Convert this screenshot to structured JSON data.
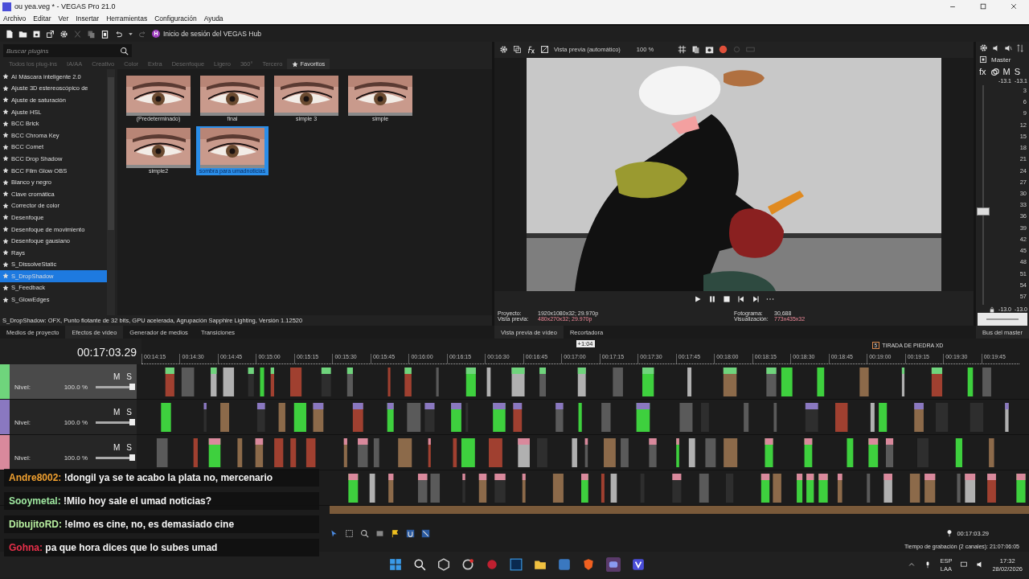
{
  "window": {
    "title": "ou yea.veg * - VEGAS Pro 21.0"
  },
  "menu": [
    "Archivo",
    "Editar",
    "Ver",
    "Insertar",
    "Herramientas",
    "Configuración",
    "Ayuda"
  ],
  "toolbar": {
    "hub_badge": "H",
    "hub_label": "Inicio de sesión del VEGAS Hub"
  },
  "plugins": {
    "search_placeholder": "Buscar plugins",
    "categories": [
      {
        "label": "Todos los plug-ins",
        "selected": false
      },
      {
        "label": "IA/AA",
        "selected": false
      },
      {
        "label": "Creativo",
        "selected": false
      },
      {
        "label": "Color",
        "selected": false
      },
      {
        "label": "Extra",
        "selected": false
      },
      {
        "label": "Desenfoque",
        "selected": false
      },
      {
        "label": "Ligero",
        "selected": false
      },
      {
        "label": "360°",
        "selected": false
      },
      {
        "label": "Tercero",
        "selected": false
      },
      {
        "label": "Favoritos",
        "selected": true
      }
    ],
    "items": [
      {
        "label": "AI Máscara inteligente 2.0",
        "selected": false
      },
      {
        "label": "Ajuste 3D estereoscópico de",
        "selected": false
      },
      {
        "label": "Ajuste de saturación",
        "selected": false
      },
      {
        "label": "Ajuste HSL",
        "selected": false
      },
      {
        "label": "BCC Brick",
        "selected": false
      },
      {
        "label": "BCC Chroma Key",
        "selected": false
      },
      {
        "label": "BCC Comet",
        "selected": false
      },
      {
        "label": "BCC Drop Shadow",
        "selected": false
      },
      {
        "label": "BCC Film Glow OBS",
        "selected": false
      },
      {
        "label": "Blanco y negro",
        "selected": false
      },
      {
        "label": "Clave cromática",
        "selected": false
      },
      {
        "label": "Corrector de color",
        "selected": false
      },
      {
        "label": "Desenfoque",
        "selected": false
      },
      {
        "label": "Desenfoque de movimiento",
        "selected": false
      },
      {
        "label": "Desenfoque gausiano",
        "selected": false
      },
      {
        "label": "Rays",
        "selected": false
      },
      {
        "label": "S_DissolveStatic",
        "selected": false
      },
      {
        "label": "S_DropShadow",
        "selected": true
      },
      {
        "label": "S_Feedback",
        "selected": false
      },
      {
        "label": "S_GlowEdges",
        "selected": false
      }
    ],
    "presets": [
      {
        "label": "(Predeterminado)",
        "selected": false
      },
      {
        "label": "final",
        "selected": false
      },
      {
        "label": "simple 3",
        "selected": false
      },
      {
        "label": "simple",
        "selected": false
      },
      {
        "label": "simple2",
        "selected": false
      },
      {
        "label": "sombra para umadnoticias",
        "selected": true
      }
    ],
    "description": "S_DropShadow: OFX, Punto flotante de 32 bits, GPU acelerada, Agrupación  Sapphire Lighting, Versión 1.12520"
  },
  "preview": {
    "mode": "Vista previa (automático)",
    "zoom": "100 %",
    "info_left": [
      {
        "label": "Proyecto:",
        "value": "1920x1080x32; 29.970p",
        "highlight": false
      },
      {
        "label": "Vista previa:",
        "value": "480x270x32; 29.970p",
        "highlight": true
      }
    ],
    "info_right": [
      {
        "label": "Fotograma:",
        "value": "30,688",
        "highlight": false
      },
      {
        "label": "Visualización:",
        "value": "773x435x32",
        "highlight": true
      }
    ]
  },
  "mixer": {
    "title": "Master",
    "fx": "fx",
    "mute": "M",
    "solo": "S",
    "peaks": [
      "-13.1",
      "-13.1"
    ],
    "scale": [
      "3",
      "6",
      "9",
      "12",
      "15",
      "18",
      "21",
      "24",
      "27",
      "30",
      "33",
      "36",
      "39",
      "42",
      "45",
      "48",
      "51",
      "54",
      "57"
    ],
    "levels": [
      "-13.0",
      "-13.0"
    ],
    "tab": "Bus del master"
  },
  "dock_tabs_left": [
    {
      "label": "Medios de proyecto",
      "selected": false
    },
    {
      "label": "Efectos de vídeo",
      "selected": true
    },
    {
      "label": "Generador de medios",
      "selected": false
    },
    {
      "label": "Transiciones",
      "selected": false
    }
  ],
  "dock_tabs_right": [
    {
      "label": "Vista previa de vídeo",
      "selected": true
    },
    {
      "label": "Recortadora",
      "selected": false
    }
  ],
  "timeline": {
    "timecode": "00:17:03.29",
    "cursor_offset": "+1:04",
    "marker": {
      "number": "5",
      "label": "TIRADA DE PIEDRA XD"
    },
    "ruler": [
      "00:14:15",
      "00:14:30",
      "00:14:45",
      "00:15:00",
      "00:15:15",
      "00:15:30",
      "00:15:45",
      "00:16:00",
      "00:16:15",
      "00:16:30",
      "00:16:45",
      "00:17:00",
      "00:17:15",
      "00:17:30",
      "00:17:45",
      "00:18:00",
      "00:18:15",
      "00:18:30",
      "00:18:45",
      "00:19:00",
      "00:19:15",
      "00:19:30",
      "00:19:45"
    ],
    "tracks": [
      {
        "color": "#6fd47c",
        "selected": true,
        "mute": "M",
        "solo": "S",
        "level_label": "Nivel:",
        "level_value": "100.0 %",
        "level": 1
      },
      {
        "color": "#8a78c0",
        "selected": false,
        "mute": "M",
        "solo": "S",
        "level_label": "Nivel:",
        "level_value": "100.0 %",
        "level": 1
      },
      {
        "color": "#d9899c",
        "selected": false,
        "mute": "M",
        "solo": "S",
        "level_label": "Nivel:",
        "level_value": "100.0 %",
        "level": 1
      }
    ]
  },
  "bottom_bar": {
    "time": "00:17:03.29",
    "status": "Tiempo de grabación (2 canales): 21:07:06:05"
  },
  "chat": [
    {
      "user": "Andre8002:",
      "color": "#f0a030",
      "message": "!dongil ya se te acabo la plata no, mercenario"
    },
    {
      "user": "Sooymetal:",
      "color": "#9fe8a0",
      "message": "!Milo hoy sale el umad noticias?"
    },
    {
      "user": "DibujitoRD:",
      "color": "#b8f0a0",
      "message": "!elmo es cine, no, es demasiado cine"
    },
    {
      "user": "Gohna:",
      "color": "#e8304a",
      "message": "pa que hora dices que lo subes umad"
    }
  ],
  "taskbar": {
    "language": "ESP",
    "layout": "LAA",
    "time": "17:32",
    "date": "28/02/2026"
  }
}
